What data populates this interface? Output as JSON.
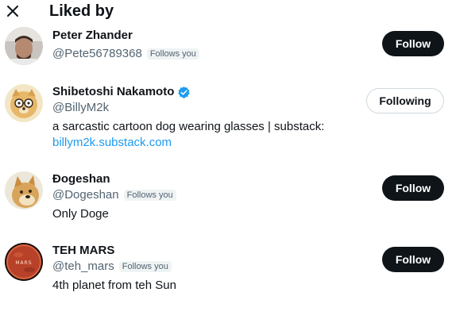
{
  "header": {
    "title": "Liked by",
    "close_icon": "close-icon"
  },
  "users": [
    {
      "name": "Peter Zhander",
      "handle": "@Pete56789368",
      "badge": "Follows you",
      "bio": "",
      "button": "Follow",
      "verified": false
    },
    {
      "name": "Shibetoshi Nakamoto",
      "handle": "@BillyM2k",
      "badge": "",
      "bio": "a sarcastic cartoon dog wearing glasses | substack:",
      "bio_link": "billym2k.substack.com",
      "button": "Following",
      "verified": true
    },
    {
      "name": "Ɖogeshan",
      "handle": "@Dogeshan",
      "badge": "Follows you",
      "bio": "Only Doge",
      "button": "Follow",
      "verified": false
    },
    {
      "name": "TEH MARS",
      "handle": "@teh_mars",
      "badge": "Follows you",
      "bio": "4th planet from teh Sun",
      "button": "Follow",
      "verified": false,
      "avatar_text": "MARS"
    }
  ],
  "colors": {
    "text": "#0f1419",
    "muted": "#536471",
    "link": "#1d9bf0",
    "verified": "#1d9bf0",
    "follow_bg": "#0f1419"
  }
}
